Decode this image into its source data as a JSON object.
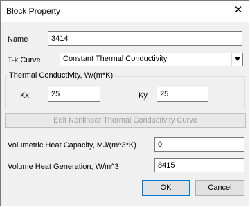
{
  "window": {
    "title": "Block Property",
    "close_glyph": "✕"
  },
  "name": {
    "label": "Name",
    "value": "3414"
  },
  "tk_curve": {
    "label": "T-k Curve",
    "selected": "Constant Thermal Conductivity"
  },
  "conductivity_group": {
    "title": "Thermal Conductivity, W/(m*K)",
    "kx_label": "Kx",
    "kx_value": "25",
    "ky_label": "Ky",
    "ky_value": "25"
  },
  "edit_curve_button": {
    "label": "Edit Nonlinear Thermal Conductivity Curve"
  },
  "heat_capacity": {
    "label": "Volumetric Heat Capacity, MJ/(m^3*K)",
    "value": "0"
  },
  "heat_generation": {
    "label": "Volume Heat Generation, W/m^3",
    "value": "8415"
  },
  "buttons": {
    "ok": "OK",
    "cancel": "Cancel"
  }
}
